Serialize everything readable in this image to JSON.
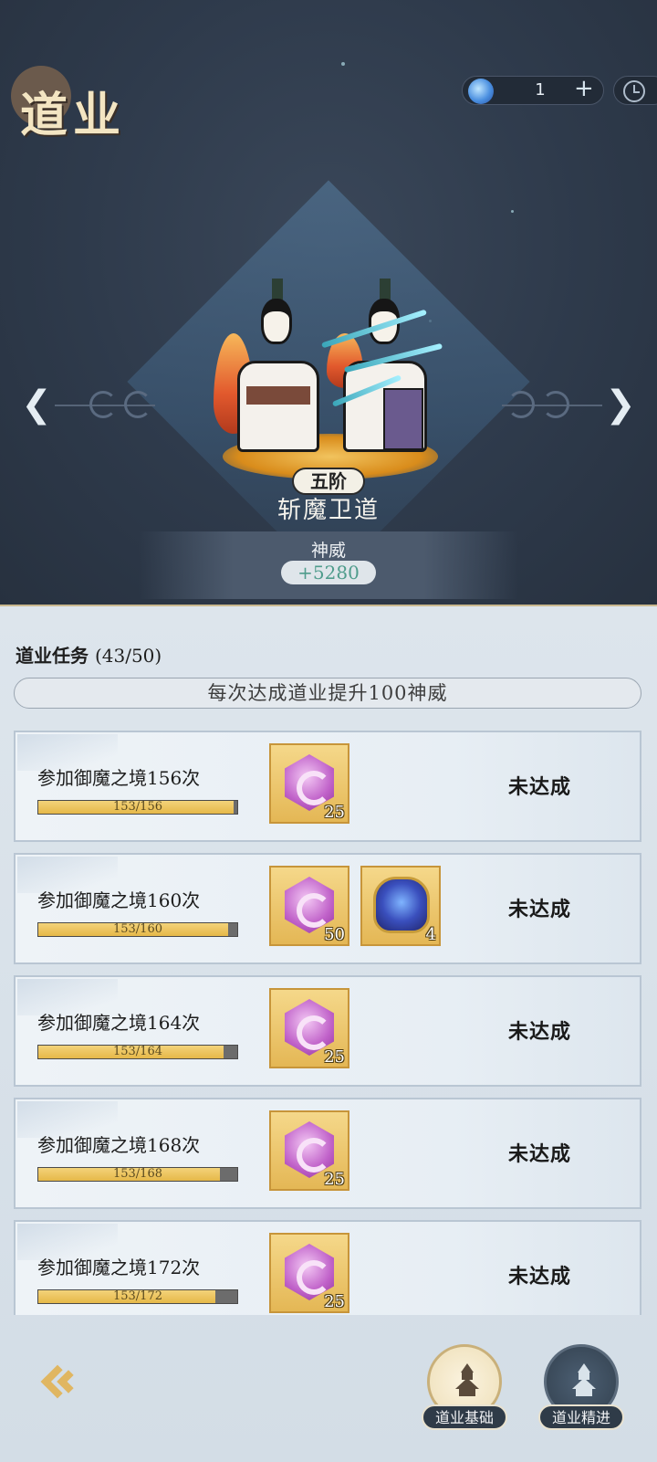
{
  "header": {
    "title": "道业",
    "resource": {
      "icon": "spirit-orb-icon",
      "count": "1",
      "plus": "+"
    },
    "clock": {
      "icon": "clock-icon"
    }
  },
  "showcase": {
    "rank": "五阶",
    "name": "斩魔卫道",
    "power_label": "神威",
    "power_value": "+5280",
    "prev_icon": "arrow-left-icon",
    "next_icon": "arrow-right-icon"
  },
  "tasks": {
    "header": "道业任务",
    "progress": "(43/50)",
    "banner": "每次达成道业提升100神威",
    "items": [
      {
        "name": "参加御魔之境156次",
        "progress_text": "153/156",
        "fill": 0.98,
        "rewards": [
          {
            "icon": "purple-gem-icon",
            "qty": "25"
          }
        ],
        "status": "未达成"
      },
      {
        "name": "参加御魔之境160次",
        "progress_text": "153/160",
        "fill": 0.956,
        "rewards": [
          {
            "icon": "purple-gem-icon",
            "qty": "50"
          },
          {
            "icon": "treasure-bag-icon",
            "qty": "4"
          }
        ],
        "status": "未达成"
      },
      {
        "name": "参加御魔之境164次",
        "progress_text": "153/164",
        "fill": 0.933,
        "rewards": [
          {
            "icon": "purple-gem-icon",
            "qty": "25"
          }
        ],
        "status": "未达成"
      },
      {
        "name": "参加御魔之境168次",
        "progress_text": "153/168",
        "fill": 0.911,
        "rewards": [
          {
            "icon": "purple-gem-icon",
            "qty": "25"
          }
        ],
        "status": "未达成"
      },
      {
        "name": "参加御魔之境172次",
        "progress_text": "153/172",
        "fill": 0.89,
        "rewards": [
          {
            "icon": "purple-gem-icon",
            "qty": "25"
          }
        ],
        "status": "未达成"
      }
    ]
  },
  "footer": {
    "back_icon": "back-arrow-icon",
    "tab_basic": "道业基础",
    "tab_advanced": "道业精进",
    "colors": {
      "basic_circle": "#f4ead2",
      "advanced_circle": "#3c4d5e",
      "accent": "#e0b661"
    }
  }
}
